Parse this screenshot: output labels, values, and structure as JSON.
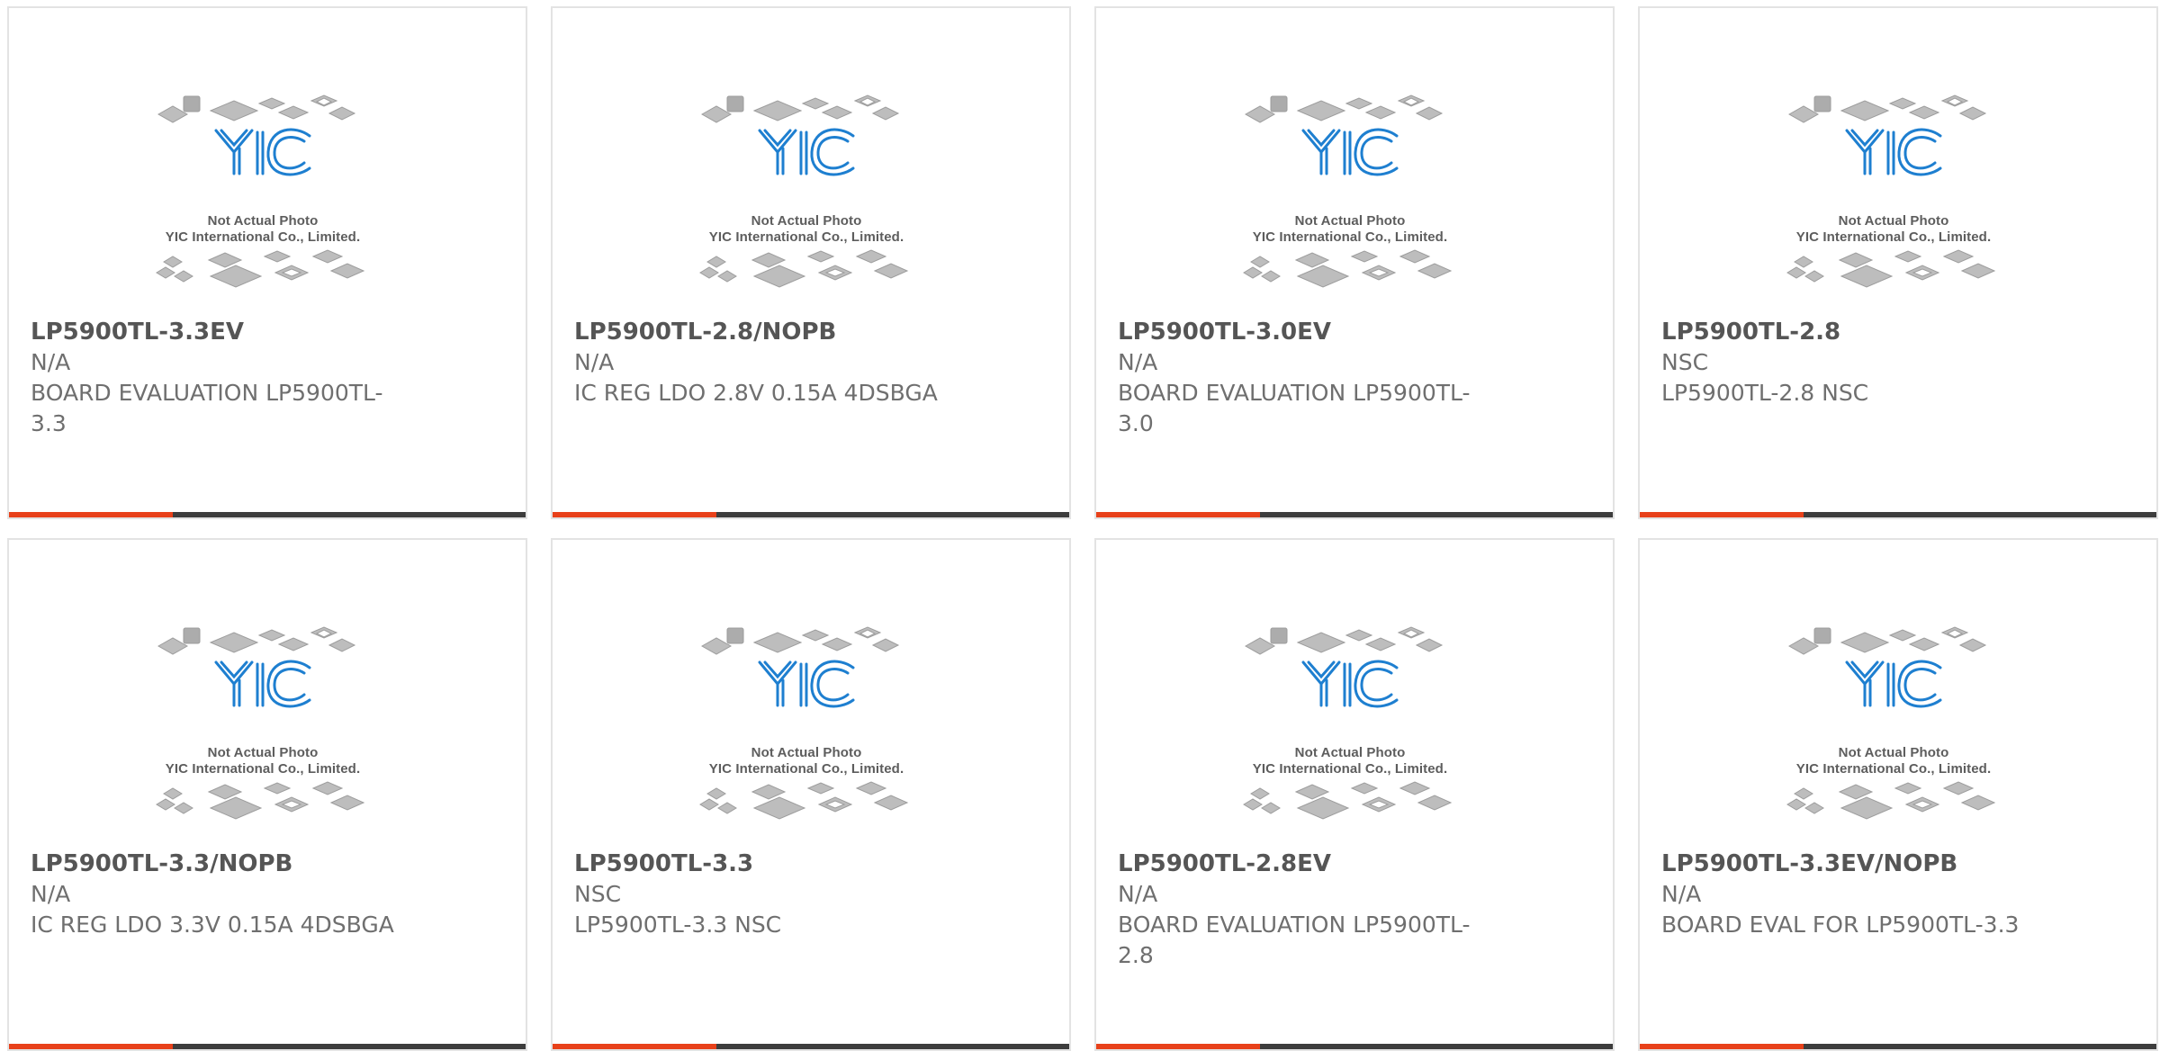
{
  "colors": {
    "accent": "#e8411a",
    "bar": "#3d3d3d",
    "logo": "#1e7fd0",
    "chip": "#b9b9b9"
  },
  "placeholder": {
    "line1": "Not Actual Photo",
    "line2": "YIC International Co., Limited."
  },
  "products": [
    {
      "part": "LP5900TL-3.3EV",
      "maker": "N/A",
      "desc": "BOARD EVALUATION LP5900TL-3.3"
    },
    {
      "part": "LP5900TL-2.8/NOPB",
      "maker": "N/A",
      "desc": "IC REG LDO 2.8V 0.15A 4DSBGA"
    },
    {
      "part": "LP5900TL-3.0EV",
      "maker": "N/A",
      "desc": "BOARD EVALUATION LP5900TL-3.0"
    },
    {
      "part": "LP5900TL-2.8",
      "maker": "NSC",
      "desc": "LP5900TL-2.8 NSC"
    },
    {
      "part": "LP5900TL-3.3/NOPB",
      "maker": "N/A",
      "desc": "IC REG LDO 3.3V 0.15A 4DSBGA"
    },
    {
      "part": "LP5900TL-3.3",
      "maker": "NSC",
      "desc": "LP5900TL-3.3 NSC"
    },
    {
      "part": "LP5900TL-2.8EV",
      "maker": "N/A",
      "desc": "BOARD EVALUATION LP5900TL-2.8"
    },
    {
      "part": "LP5900TL-3.3EV/NOPB",
      "maker": "N/A",
      "desc": "BOARD EVAL FOR LP5900TL-3.3"
    }
  ]
}
